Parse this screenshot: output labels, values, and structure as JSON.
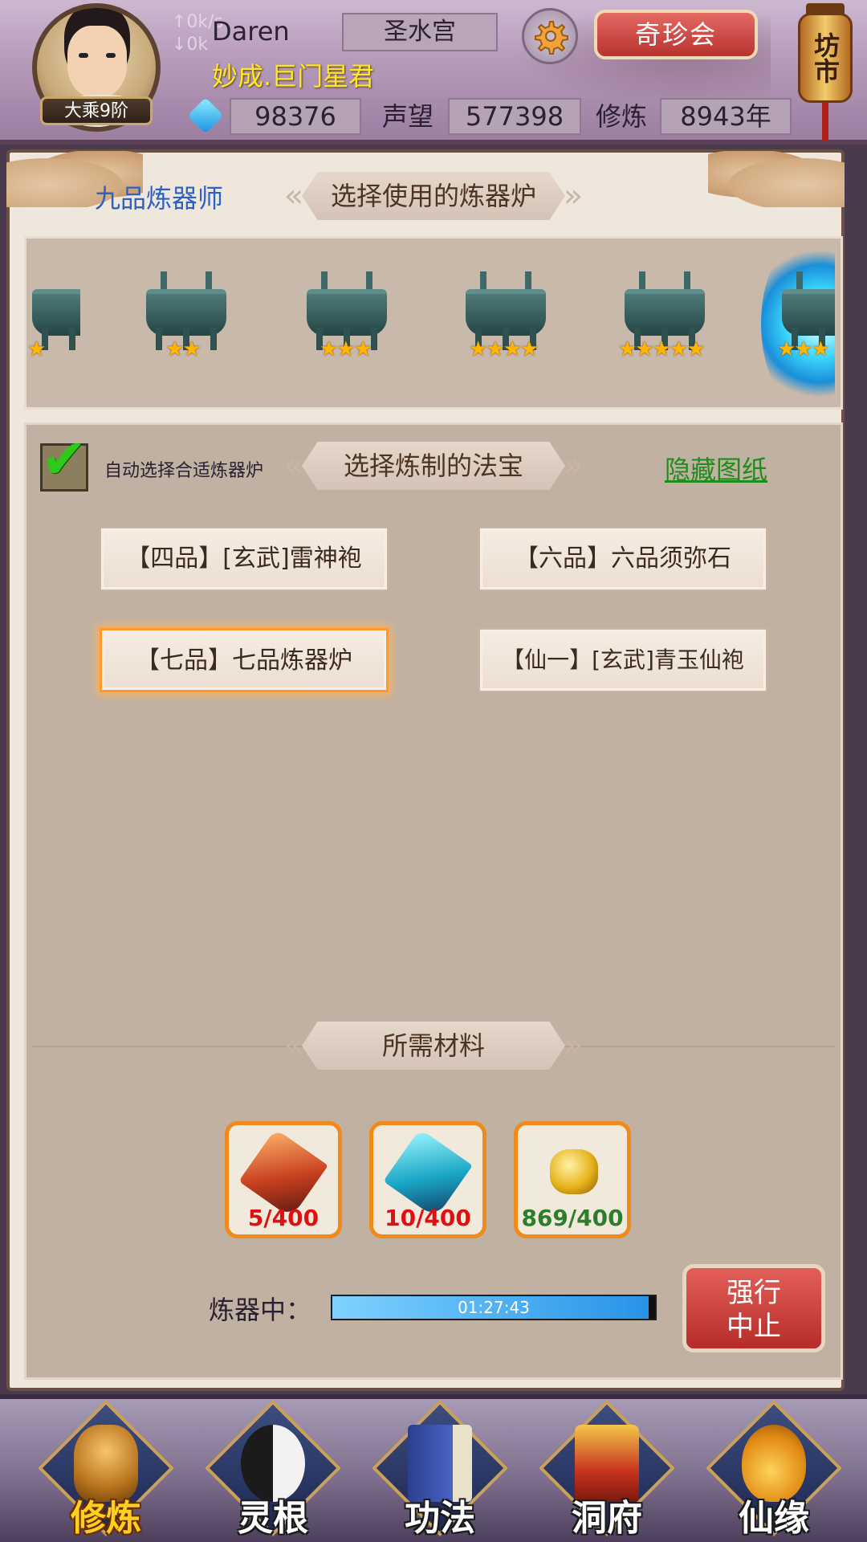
{
  "header": {
    "net_up": "↑0k/s",
    "net_down": "↓0k",
    "player_name": "Daren",
    "player_title": "妙成.巨门星君",
    "realm": "大乘9阶",
    "sect": "圣水宫",
    "qizhen_label": "奇珍会",
    "market_label": "坊市",
    "stats": {
      "spirit_stones": "98376",
      "prestige_label": "声望",
      "prestige": "577398",
      "cultivation_label": "修炼",
      "cultivation": "8943年"
    }
  },
  "forge": {
    "smith_rank": "九品炼器师",
    "furnace_section_title": "选择使用的炼器炉",
    "furnaces": [
      {
        "stars": 1
      },
      {
        "stars": 2
      },
      {
        "stars": 3
      },
      {
        "stars": 4
      },
      {
        "stars": 5
      },
      {
        "stars": 3
      }
    ],
    "auto_select_label": "自动选择合适炼器炉",
    "auto_select_checked": true,
    "treasure_section_title": "选择炼制的法宝",
    "hide_recipes_label": "隐藏图纸",
    "recipes": [
      {
        "label": "【四品】[玄武]雷神袍",
        "selected": false
      },
      {
        "label": "【六品】六品须弥石",
        "selected": false
      },
      {
        "label": "【七品】七品炼器炉",
        "selected": true
      },
      {
        "label": "【仙一】[玄武]青玉仙袍",
        "selected": false
      }
    ],
    "materials_title": "所需材料",
    "materials": [
      {
        "icon": "red-crystal-icon",
        "count": "5/400",
        "sufficient": false
      },
      {
        "icon": "blue-crystal-icon",
        "count": "10/400",
        "sufficient": false
      },
      {
        "icon": "gold-ore-icon",
        "count": "869/400",
        "sufficient": true
      }
    ],
    "progress_label": "炼器中：",
    "progress_time": "01:27:43",
    "progress_fraction": 0.98,
    "force_stop_line1": "强行",
    "force_stop_line2": "中止"
  },
  "nav": [
    {
      "label": "修炼",
      "icon": "cultivate-icon",
      "active": true
    },
    {
      "label": "灵根",
      "icon": "spirit-root-icon",
      "active": false
    },
    {
      "label": "功法",
      "icon": "technique-book-icon",
      "active": false
    },
    {
      "label": "洞府",
      "icon": "cave-dwelling-icon",
      "active": false
    },
    {
      "label": "仙缘",
      "icon": "immortal-fate-icon",
      "active": false
    }
  ],
  "colors": {
    "accent_orange": "#f08a1a",
    "insufficient_red": "#e01010",
    "sufficient_green": "#2d7d2a",
    "title_yellow": "#ffe826",
    "link_green": "#1f8d1b",
    "rank_blue": "#2e62c2"
  }
}
